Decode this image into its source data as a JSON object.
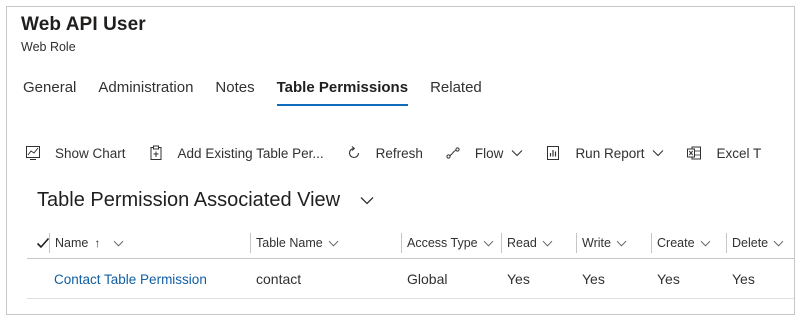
{
  "record": {
    "title": "Web API User",
    "subtitle": "Web Role"
  },
  "tabs": [
    {
      "label": "General",
      "active": false
    },
    {
      "label": "Administration",
      "active": false
    },
    {
      "label": "Notes",
      "active": false
    },
    {
      "label": "Table Permissions",
      "active": true
    },
    {
      "label": "Related",
      "active": false
    }
  ],
  "commands": [
    {
      "label": "Show Chart",
      "icon": "chart-icon"
    },
    {
      "label": "Add Existing Table Per...",
      "icon": "add-existing-icon"
    },
    {
      "label": "Refresh",
      "icon": "refresh-icon"
    },
    {
      "label": "Flow",
      "icon": "flow-icon",
      "dropdown": true
    },
    {
      "label": "Run Report",
      "icon": "report-icon",
      "dropdown": true
    },
    {
      "label": "Excel T",
      "icon": "excel-icon"
    }
  ],
  "view": {
    "title": "Table Permission Associated View"
  },
  "grid": {
    "columns": [
      {
        "label": "Name",
        "sort": "↑"
      },
      {
        "label": "Table Name"
      },
      {
        "label": "Access Type"
      },
      {
        "label": "Read"
      },
      {
        "label": "Write"
      },
      {
        "label": "Create"
      },
      {
        "label": "Delete"
      }
    ],
    "rows": [
      {
        "name": "Contact Table Permission",
        "table_name": "contact",
        "access_type": "Global",
        "read": "Yes",
        "write": "Yes",
        "create": "Yes",
        "delete": "Yes"
      }
    ]
  },
  "colors": {
    "accent": "#0f6cbd",
    "link": "#115ea3",
    "border": "#c8c6c4"
  }
}
